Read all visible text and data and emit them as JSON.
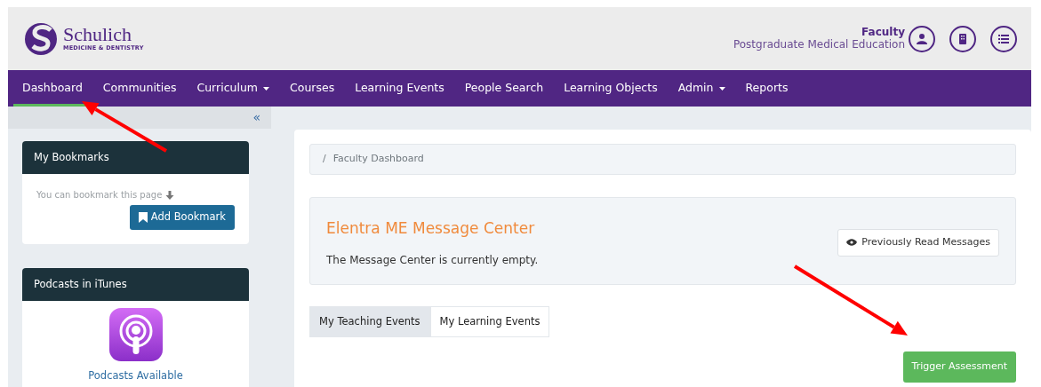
{
  "header": {
    "logo": {
      "name": "Schulich",
      "tagline": "MEDICINE & DENTISTRY"
    },
    "user": {
      "role": "Faculty",
      "organisation": "Postgraduate Medical Education"
    }
  },
  "nav": [
    {
      "label": "Dashboard",
      "selected": true,
      "dropdown": false
    },
    {
      "label": "Communities",
      "selected": false,
      "dropdown": false
    },
    {
      "label": "Curriculum",
      "selected": false,
      "dropdown": true
    },
    {
      "label": "Courses",
      "selected": false,
      "dropdown": false
    },
    {
      "label": "Learning Events",
      "selected": false,
      "dropdown": false
    },
    {
      "label": "People Search",
      "selected": false,
      "dropdown": false
    },
    {
      "label": "Learning Objects",
      "selected": false,
      "dropdown": false
    },
    {
      "label": "Admin",
      "selected": false,
      "dropdown": true
    },
    {
      "label": "Reports",
      "selected": false,
      "dropdown": false
    }
  ],
  "sidebar": {
    "collapse": "«",
    "bookmarks": {
      "title": "My Bookmarks",
      "hint": "You can bookmark this page",
      "button": "Add Bookmark"
    },
    "podcasts": {
      "title": "Podcasts in iTunes",
      "link": "Podcasts Available"
    }
  },
  "breadcrumb": {
    "separator": "/",
    "label": "Faculty Dashboard"
  },
  "message_center": {
    "title": "Elentra ME Message Center",
    "text": "The Message Center is currently empty.",
    "button": "Previously Read Messages"
  },
  "tabs": [
    {
      "label": "My Teaching Events",
      "selected": true
    },
    {
      "label": "My Learning Events",
      "selected": false
    }
  ],
  "action_button": "Trigger Assessment"
}
